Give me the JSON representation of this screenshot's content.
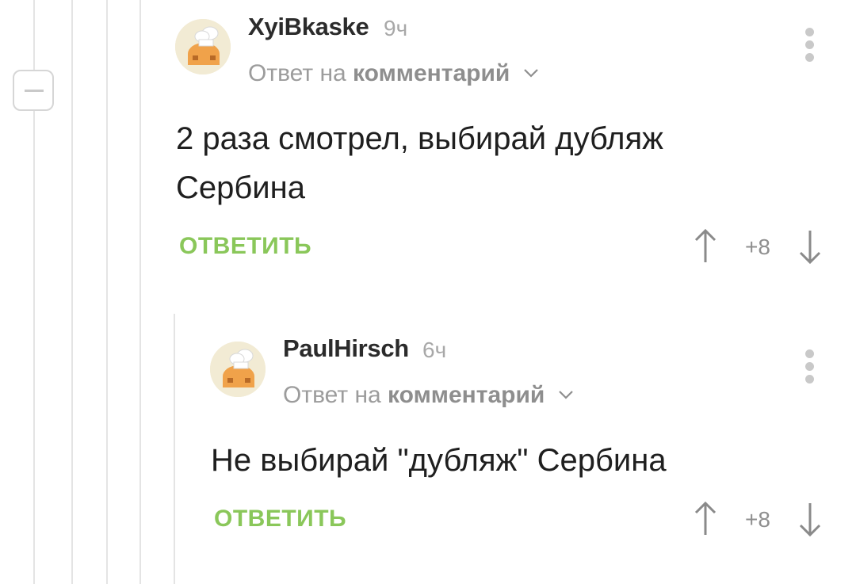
{
  "comments": [
    {
      "author": "XyiBkaske",
      "time": "9ч",
      "reply_to_prefix": "Ответ на",
      "reply_to_target": "комментарий",
      "text": "2 раза смотрел, выбирай дубляж Сербина",
      "reply_label": "ОТВЕТИТЬ",
      "rating": "+8"
    },
    {
      "author": "PaulHirsch",
      "time": "6ч",
      "reply_to_prefix": "Ответ на",
      "reply_to_target": "комментарий",
      "text": "Не выбирай \"дубляж\" Сербина",
      "reply_label": "ОТВЕТИТЬ",
      "rating": "+8"
    }
  ],
  "colors": {
    "accent_green": "#8ac75a",
    "muted_gray": "#9c9c9c"
  },
  "icons": [
    "avatar-image",
    "chevron-down-icon",
    "more-vertical-icon",
    "upvote-arrow-icon",
    "downvote-arrow-icon",
    "collapse-thread-icon"
  ]
}
